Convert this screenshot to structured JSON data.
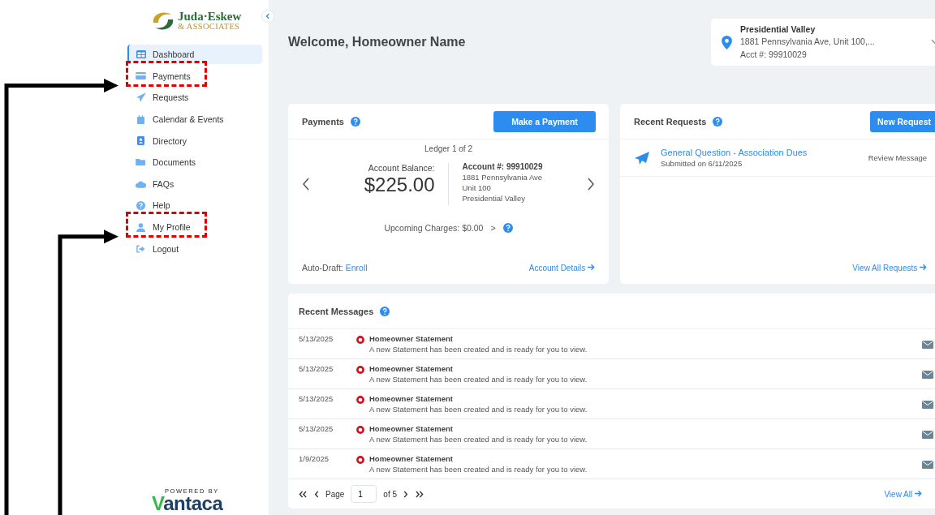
{
  "logo": {
    "name": "Juda·Eskew",
    "subtitle": "& ASSOCIATES"
  },
  "sidebar": {
    "items": [
      {
        "label": "Dashboard",
        "selected": true,
        "highlighted": false
      },
      {
        "label": "Payments",
        "selected": false,
        "highlighted": true
      },
      {
        "label": "Requests",
        "selected": false,
        "highlighted": false
      },
      {
        "label": "Calendar & Events",
        "selected": false,
        "highlighted": false
      },
      {
        "label": "Directory",
        "selected": false,
        "highlighted": false
      },
      {
        "label": "Documents",
        "selected": false,
        "highlighted": false
      },
      {
        "label": "FAQs",
        "selected": false,
        "highlighted": false
      },
      {
        "label": "Help",
        "selected": false,
        "highlighted": false
      },
      {
        "label": "My Profile",
        "selected": false,
        "highlighted": true
      },
      {
        "label": "Logout",
        "selected": false,
        "highlighted": false
      }
    ],
    "powered_by": "POWERED BY",
    "brand": "Vantaca"
  },
  "header": {
    "title": "Welcome, Homeowner Name"
  },
  "account_selector": {
    "community": "Presidential Valley",
    "address": "1881 Pennsylvania Ave, Unit 100,...",
    "account": "Acct #: 99910029"
  },
  "payments": {
    "title": "Payments",
    "button": "Make a Payment",
    "ledger": "Ledger 1 of 2",
    "balance_label": "Account Balance:",
    "balance": "$225.00",
    "account_number": "Account #: 99910029",
    "address_lines": [
      "1881 Pennsylvania Ave",
      "Unit 100",
      "Presidential Valley"
    ],
    "upcoming": "Upcoming Charges: $0.00",
    "upcoming_caret": ">",
    "auto_draft_label": "Auto-Draft:",
    "auto_draft_link": "Enroll",
    "details_link": "Account Details"
  },
  "requests": {
    "title": "Recent Requests",
    "button": "New Request",
    "items": [
      {
        "title": "General Question - Association Dues",
        "submitted": "Submitted on 6/11/2025",
        "action": "Review Message"
      }
    ],
    "view_all": "View All Requests"
  },
  "messages": {
    "title": "Recent Messages",
    "rows": [
      {
        "date": "5/13/2025",
        "unread": true,
        "title": "Homeowner Statement",
        "body": "A new Statement has been created and is ready for you to view."
      },
      {
        "date": "5/13/2025",
        "unread": true,
        "title": "Homeowner Statement",
        "body": "A new Statement has been created and is ready for you to view."
      },
      {
        "date": "5/13/2025",
        "unread": true,
        "title": "Homeowner Statement",
        "body": "A new Statement has been created and is ready for you to view."
      },
      {
        "date": "5/13/2025",
        "unread": true,
        "title": "Homeowner Statement",
        "body": "A new Statement has been created and is ready for you to view."
      },
      {
        "date": "1/9/2025",
        "unread": true,
        "title": "Homeowner Statement",
        "body": "A new Statement has been created and is ready for you to view."
      }
    ],
    "pager": {
      "label": "Page",
      "page": "1",
      "of": "of 5"
    },
    "view_all": "View All"
  }
}
